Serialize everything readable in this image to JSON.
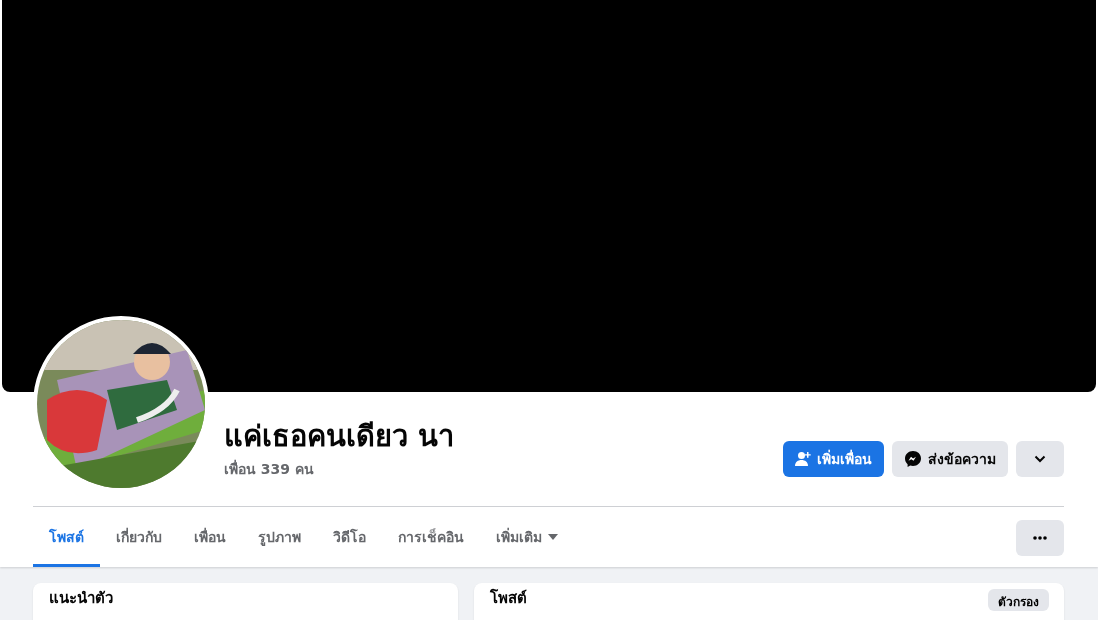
{
  "profile": {
    "name": "แค่เธอคนเดียว นา",
    "friends": "เพื่อน 339 คน"
  },
  "actions": [
    {
      "kind": "add-friend",
      "label": "เพิ่มเพื่อน"
    },
    {
      "kind": "message",
      "label": "ส่งข้อความ"
    },
    {
      "kind": "more"
    }
  ],
  "tabs": [
    {
      "label": "โพสต์",
      "selected": true,
      "dropdown": false
    },
    {
      "label": "เกี่ยวกับ",
      "selected": false,
      "dropdown": false
    },
    {
      "label": "เพื่อน",
      "selected": false,
      "dropdown": false
    },
    {
      "label": "รูปภาพ",
      "selected": false,
      "dropdown": false
    },
    {
      "label": "วิดีโอ",
      "selected": false,
      "dropdown": false
    },
    {
      "label": "การเช็คอิน",
      "selected": false,
      "dropdown": false
    },
    {
      "label": "เพิ่มเติม",
      "selected": false,
      "dropdown": true
    }
  ],
  "intro_card": {
    "title": "แนะนำตัว"
  },
  "posts_card": {
    "title": "โพสต์",
    "filter_button": "ตัวกรอง"
  }
}
